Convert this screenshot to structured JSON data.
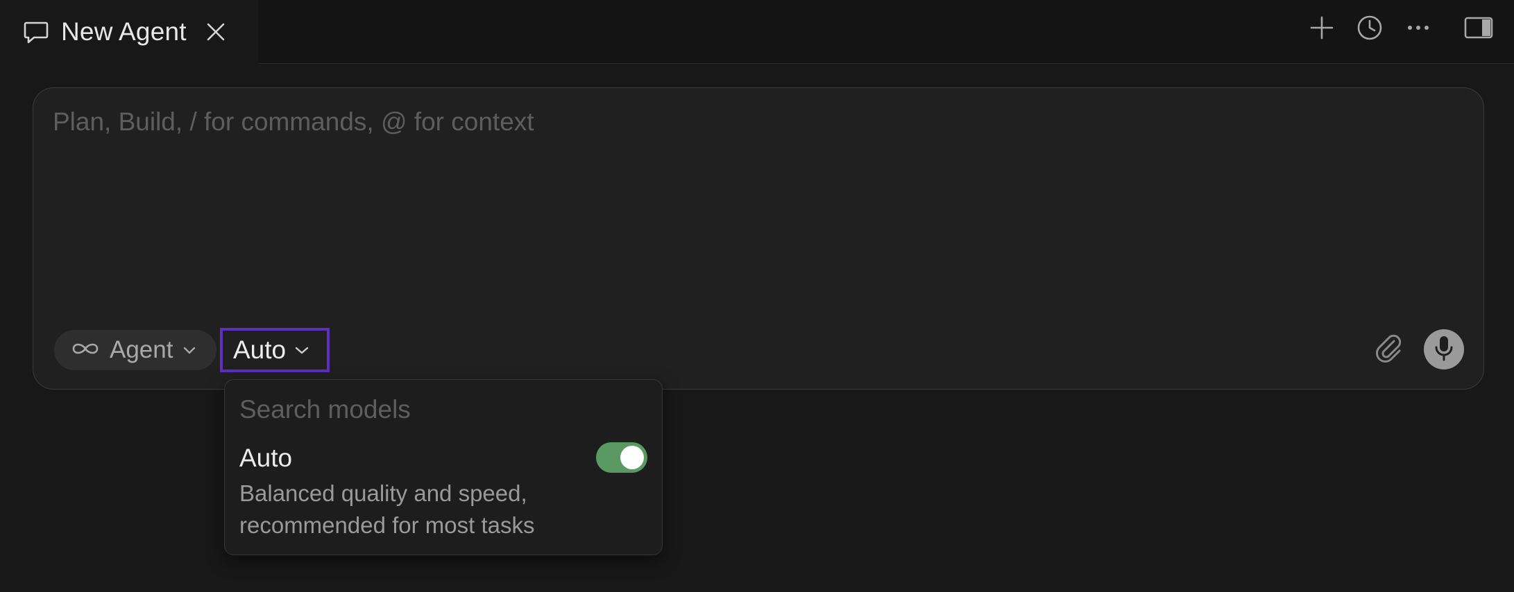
{
  "tab": {
    "title": "New Agent",
    "icon": "chat-bubble-icon",
    "close_icon": "close-icon"
  },
  "toolbar": {
    "icons": [
      "plus-icon",
      "history-clock-icon",
      "more-dots-icon",
      "toggle-panel-icon"
    ]
  },
  "composer": {
    "placeholder": "Plan, Build, / for commands, @ for context",
    "value": "",
    "mode": {
      "label": "Agent",
      "icon": "infinity-icon"
    },
    "model": {
      "label": "Auto",
      "focus_color": "#5b2fc1"
    },
    "attach_icon": "paperclip-icon",
    "mic_icon": "microphone-icon"
  },
  "model_dropdown": {
    "search_placeholder": "Search models",
    "search_value": "",
    "options": [
      {
        "title": "Auto",
        "description": "Balanced quality and speed, recommended for most tasks",
        "enabled": true
      }
    ],
    "toggle_color": "#5a9a62"
  }
}
